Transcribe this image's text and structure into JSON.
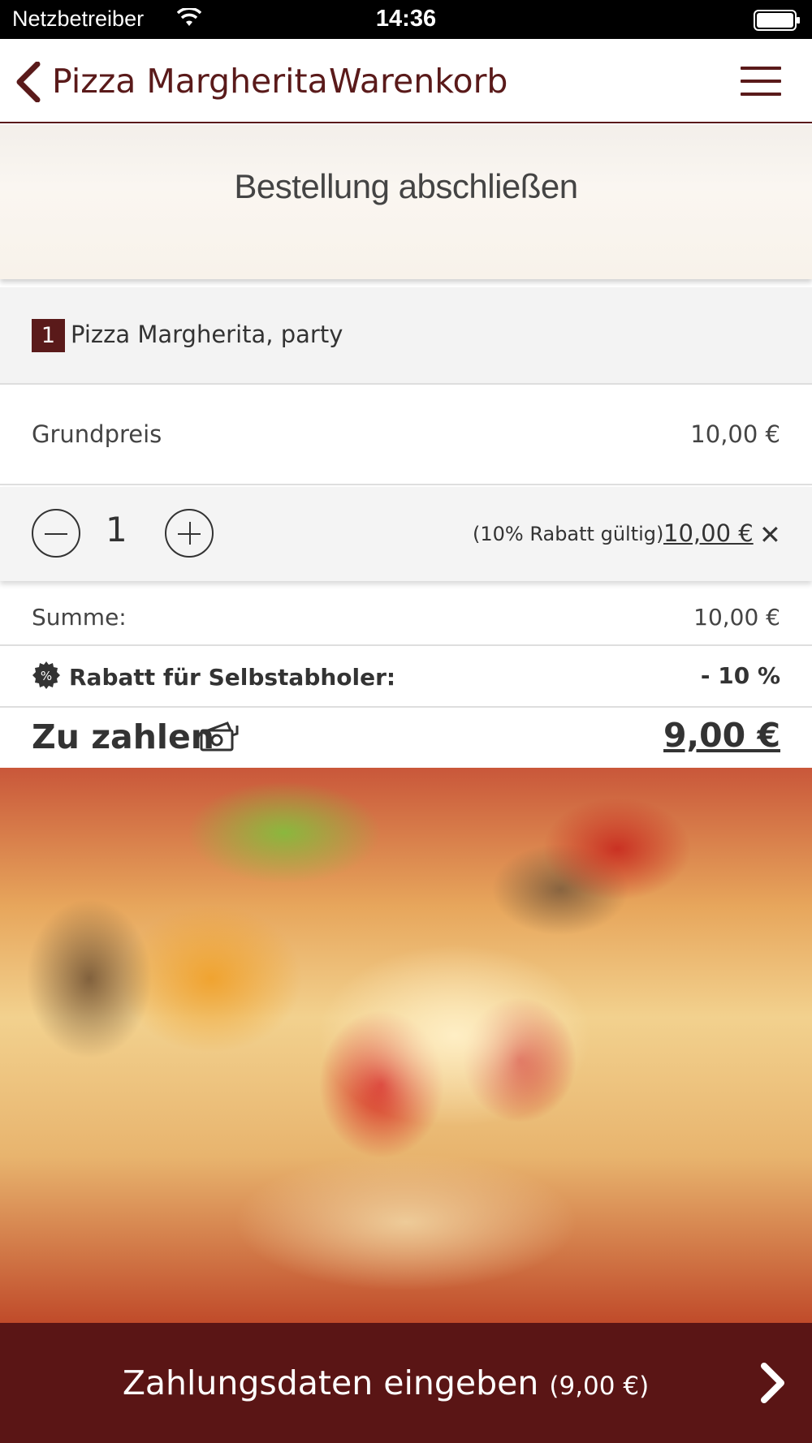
{
  "status_bar": {
    "carrier": "Netzbetreiber",
    "time": "14:36",
    "icons": [
      "wifi-icon",
      "battery-icon"
    ]
  },
  "nav": {
    "back_label": "Pizza Margherita",
    "title": "Warenkorb",
    "accent_color": "#5a1a1a",
    "icons": [
      "chevron-left-icon",
      "hamburger-menu-icon"
    ]
  },
  "banner": {
    "title": "Bestellung abschließen"
  },
  "cart_item": {
    "quantity_badge": "1",
    "name": "Pizza Margherita, party",
    "base_price_label": "Grundpreis",
    "base_price_value": "10,00 €",
    "quantity": "1",
    "discount_note": "(10% Rabatt gültig)",
    "line_total": "10,00 €",
    "remove_symbol": "✕"
  },
  "totals": {
    "sum_label": "Summe:",
    "sum_value": "10,00 €",
    "discount_label": "Rabatt für Selbstabholer:",
    "discount_value": "- 10 %",
    "discount_icon_glyph": "%",
    "pay_label": "Zu zahlen",
    "pay_value": "9,00 €"
  },
  "cta": {
    "label": "Zahlungsdaten eingeben",
    "amount": "(9,00 €)",
    "background": "#5a1515",
    "icon": "chevron-right-icon"
  }
}
